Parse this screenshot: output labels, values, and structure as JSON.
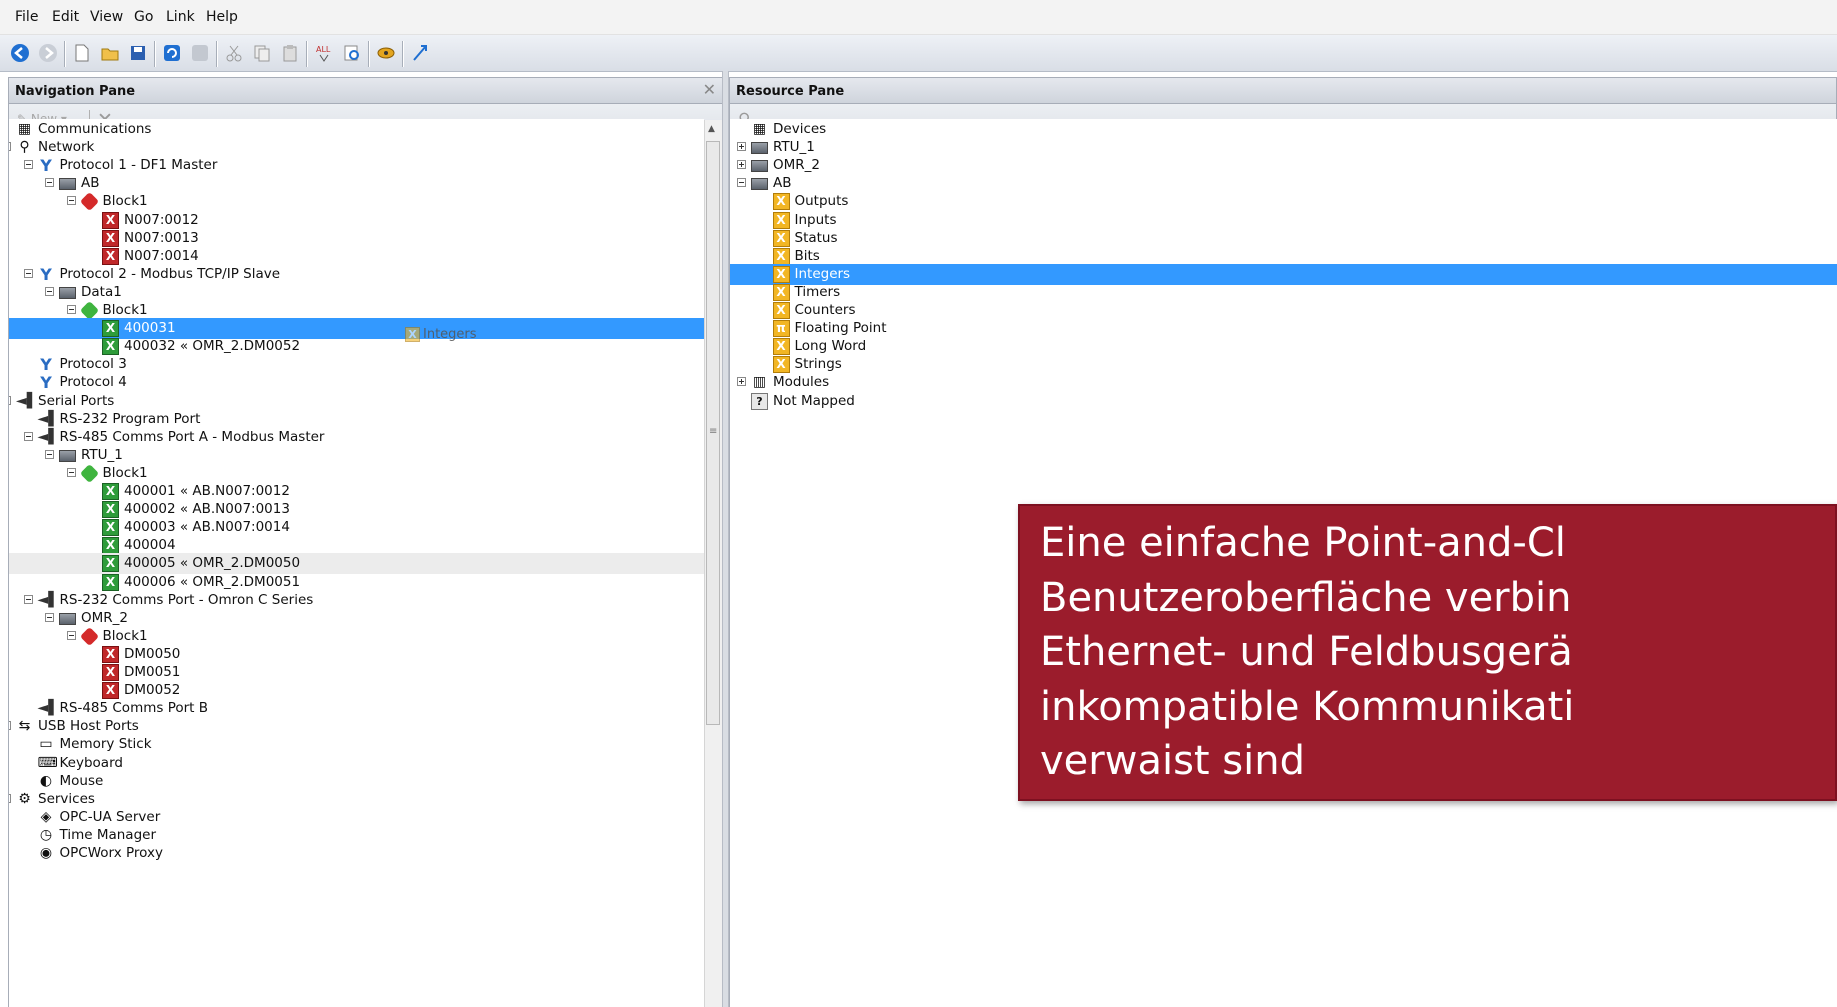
{
  "menu": [
    "File",
    "Edit",
    "View",
    "Go",
    "Link",
    "Help"
  ],
  "nav_pane": {
    "title": "Navigation Pane",
    "new_label": "New",
    "tree": [
      {
        "level": 0,
        "label": "Communications",
        "icon": "communications-icon",
        "expander": "none"
      },
      {
        "level": 0,
        "label": "Network",
        "icon": "network-icon",
        "expander": "minus"
      },
      {
        "level": 1,
        "label": "Protocol 1 - DF1 Master",
        "icon": "protocol-icon",
        "expander": "minus"
      },
      {
        "level": 2,
        "label": "AB",
        "icon": "device-icon",
        "expander": "minus"
      },
      {
        "level": 3,
        "label": "Block1",
        "icon": "red-block-icon",
        "expander": "minus"
      },
      {
        "level": 4,
        "label": "N007:0012",
        "icon": "red-tag-icon"
      },
      {
        "level": 4,
        "label": "N007:0013",
        "icon": "red-tag-icon"
      },
      {
        "level": 4,
        "label": "N007:0014",
        "icon": "red-tag-icon"
      },
      {
        "level": 1,
        "label": "Protocol 2 - Modbus TCP/IP Slave",
        "icon": "protocol-icon",
        "expander": "minus"
      },
      {
        "level": 2,
        "label": "Data1",
        "icon": "device-icon",
        "expander": "minus"
      },
      {
        "level": 3,
        "label": "Block1",
        "icon": "green-block-icon",
        "expander": "minus"
      },
      {
        "level": 4,
        "label": "400031",
        "icon": "green-tag-icon",
        "state": "selected"
      },
      {
        "level": 4,
        "label": "400032 « OMR_2.DM0052",
        "icon": "green-tag-icon"
      },
      {
        "level": 1,
        "label": "Protocol 3",
        "icon": "protocol-icon"
      },
      {
        "level": 1,
        "label": "Protocol 4",
        "icon": "protocol-icon"
      },
      {
        "level": 0,
        "label": "Serial Ports",
        "icon": "serial-ports-icon",
        "expander": "minus"
      },
      {
        "level": 1,
        "label": "RS-232 Program Port",
        "icon": "port-icon"
      },
      {
        "level": 1,
        "label": "RS-485 Comms Port A - Modbus Master",
        "icon": "port-icon",
        "expander": "minus"
      },
      {
        "level": 2,
        "label": "RTU_1",
        "icon": "device-icon",
        "expander": "minus"
      },
      {
        "level": 3,
        "label": "Block1",
        "icon": "green-block-icon",
        "expander": "minus"
      },
      {
        "level": 4,
        "label": "400001 « AB.N007:0012",
        "icon": "green-tag-icon"
      },
      {
        "level": 4,
        "label": "400002 « AB.N007:0013",
        "icon": "green-tag-icon"
      },
      {
        "level": 4,
        "label": "400003 « AB.N007:0014",
        "icon": "green-tag-icon"
      },
      {
        "level": 4,
        "label": "400004",
        "icon": "green-tag-icon"
      },
      {
        "level": 4,
        "label": "400005 « OMR_2.DM0050",
        "icon": "green-tag-icon",
        "state": "hover"
      },
      {
        "level": 4,
        "label": "400006 « OMR_2.DM0051",
        "icon": "green-tag-icon"
      },
      {
        "level": 1,
        "label": "RS-232 Comms Port - Omron C Series",
        "icon": "port-icon",
        "expander": "minus"
      },
      {
        "level": 2,
        "label": "OMR_2",
        "icon": "device-icon",
        "expander": "minus"
      },
      {
        "level": 3,
        "label": "Block1",
        "icon": "red-block-icon",
        "expander": "minus"
      },
      {
        "level": 4,
        "label": "DM0050",
        "icon": "red-tag-icon"
      },
      {
        "level": 4,
        "label": "DM0051",
        "icon": "red-tag-icon"
      },
      {
        "level": 4,
        "label": "DM0052",
        "icon": "red-tag-icon"
      },
      {
        "level": 1,
        "label": "RS-485 Comms Port B",
        "icon": "port-icon"
      },
      {
        "level": 0,
        "label": "USB Host Ports",
        "icon": "usb-icon",
        "expander": "minus"
      },
      {
        "level": 1,
        "label": "Memory Stick",
        "icon": "memory-stick-icon"
      },
      {
        "level": 1,
        "label": "Keyboard",
        "icon": "keyboard-icon"
      },
      {
        "level": 1,
        "label": "Mouse",
        "icon": "mouse-icon"
      },
      {
        "level": 0,
        "label": "Services",
        "icon": "services-icon",
        "expander": "minus"
      },
      {
        "level": 1,
        "label": "OPC-UA Server",
        "icon": "opcua-icon"
      },
      {
        "level": 1,
        "label": "Time Manager",
        "icon": "time-manager-icon"
      },
      {
        "level": 1,
        "label": "OPCWorx Proxy",
        "icon": "opcworx-icon"
      }
    ]
  },
  "drag_ghost_label": "Integers",
  "resource_pane": {
    "title": "Resource Pane",
    "tree": [
      {
        "level": 0,
        "label": "Devices",
        "icon": "devices-icon",
        "expander": "none"
      },
      {
        "level": 0,
        "label": "RTU_1",
        "icon": "device-icon",
        "expander": "plus"
      },
      {
        "level": 0,
        "label": "OMR_2",
        "icon": "device-icon",
        "expander": "plus"
      },
      {
        "level": 0,
        "label": "AB",
        "icon": "device-icon",
        "expander": "minus"
      },
      {
        "level": 1,
        "label": "Outputs",
        "icon": "yellow-tag-icon"
      },
      {
        "level": 1,
        "label": "Inputs",
        "icon": "yellow-tag-icon"
      },
      {
        "level": 1,
        "label": "Status",
        "icon": "yellow-tag-icon"
      },
      {
        "level": 1,
        "label": "Bits",
        "icon": "yellow-tag-icon"
      },
      {
        "level": 1,
        "label": "Integers",
        "icon": "yellow-tag-icon",
        "state": "selected"
      },
      {
        "level": 1,
        "label": "Timers",
        "icon": "yellow-tag-icon"
      },
      {
        "level": 1,
        "label": "Counters",
        "icon": "yellow-tag-icon"
      },
      {
        "level": 1,
        "label": "Floating Point",
        "icon": "float-tag-icon"
      },
      {
        "level": 1,
        "label": "Long Word",
        "icon": "yellow-tag-icon"
      },
      {
        "level": 1,
        "label": "Strings",
        "icon": "yellow-tag-icon"
      },
      {
        "level": 0,
        "label": "Modules",
        "icon": "modules-icon",
        "expander": "plus"
      },
      {
        "level": 0,
        "label": "Not Mapped",
        "icon": "not-mapped-icon"
      }
    ]
  },
  "overlay": {
    "text": "Eine einfache Point-and-Cl\nBenutzeroberfläche verbin\nEthernet- und Feldbusgerä\ninkompatible Kommunikati\nverwaist sind"
  },
  "colors": {
    "selection": "#3399ff",
    "overlay_bg": "#9b1c2c"
  }
}
